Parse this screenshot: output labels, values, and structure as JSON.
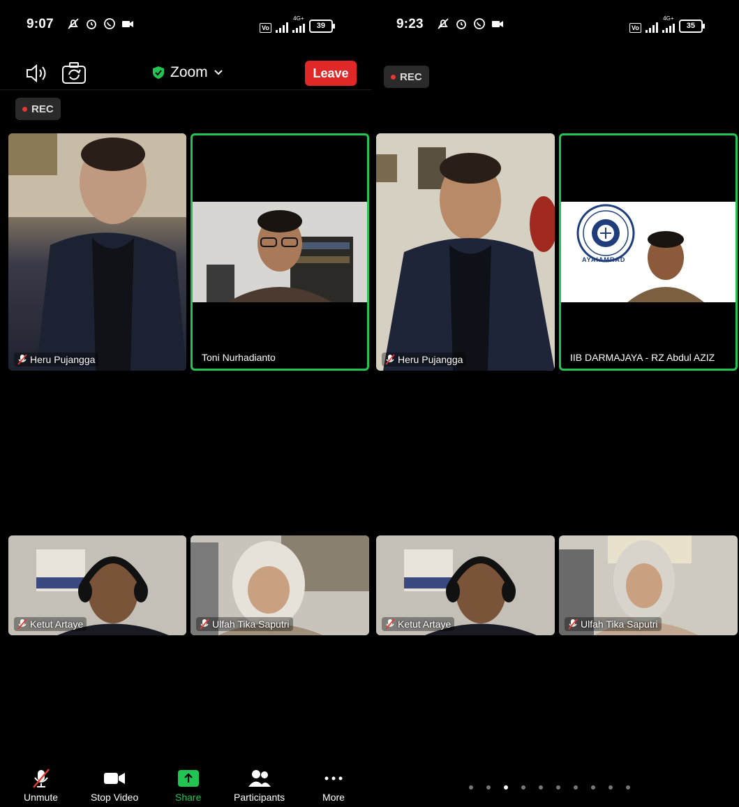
{
  "colors": {
    "accent_green": "#23c552",
    "leave_red": "#e02828",
    "rec_dot": "#e53935"
  },
  "left": {
    "status": {
      "time": "9:07",
      "battery": "39",
      "net": "4G+"
    },
    "toolbar_top": {
      "title": "Zoom",
      "leave": "Leave"
    },
    "rec": "REC",
    "tiles": {
      "t1": {
        "name": "Heru Pujangga"
      },
      "t2": {
        "name": "Toni Nurhadianto"
      },
      "t3": {
        "name": "Ketut Artaye"
      },
      "t4": {
        "name": "Ulfah Tika Saputri"
      }
    },
    "bottom": {
      "unmute": "Unmute",
      "stop_video": "Stop Video",
      "share": "Share",
      "participants": "Participants",
      "more": "More"
    }
  },
  "right": {
    "status": {
      "time": "9:23",
      "battery": "35",
      "net": "4G+"
    },
    "rec": "REC",
    "tiles": {
      "t1": {
        "name": "Heru Pujangga"
      },
      "t2": {
        "name": "IIB DARMAJAYA - RZ Abdul AZIZ"
      },
      "t3": {
        "name": "Ketut Artaye"
      },
      "t4": {
        "name": "Ulfah Tika Saputri"
      }
    },
    "pager": {
      "pages": 10,
      "active": 3
    },
    "logo_text": "AYAIAMRAD"
  }
}
